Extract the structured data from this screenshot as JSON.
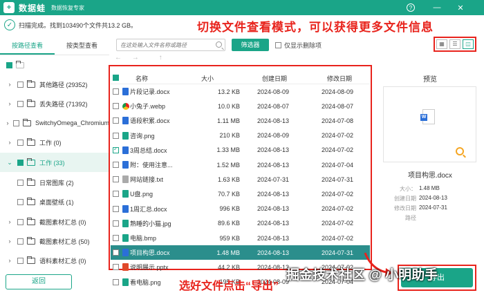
{
  "app": {
    "logo_char": "+",
    "name": "数据蛙",
    "subtitle": "数据恢复专家",
    "help": "?",
    "minimize": "—",
    "close": "✕"
  },
  "status": {
    "icon": "check-icon",
    "check_char": "✓",
    "text": "扫描完成。找到103490个文件共13.2 GB。"
  },
  "annotations": {
    "top": "切换文件查看模式，可以获得更多文件信息",
    "bottom": "选好文件点击“导出”",
    "watermark": "掘金技术社区 @ 小明助手"
  },
  "tabs": [
    {
      "label": "按路径查看",
      "active": true
    },
    {
      "label": "按类型查看",
      "active": false
    }
  ],
  "tree": [
    {
      "caret": "",
      "label": "",
      "state": "mixed"
    },
    {
      "caret": "›",
      "label": "其他路径 (29352)",
      "state": "unchecked"
    },
    {
      "caret": "›",
      "label": "丢失路径 (71392)",
      "state": "unchecked"
    },
    {
      "caret": "›",
      "label": "SwitchyOmega_Chromium",
      "state": "unchecked"
    },
    {
      "caret": "›",
      "label": "工作 (0)",
      "state": "unchecked"
    },
    {
      "caret": "⌄",
      "label": "工作 (33)",
      "state": "mixed"
    },
    {
      "caret": "",
      "label": "日常图库 (2)",
      "state": "unchecked"
    },
    {
      "caret": "",
      "label": "桌面壁纸 (1)",
      "state": "unchecked"
    },
    {
      "caret": "›",
      "label": "截图素材汇总 (0)",
      "state": "unchecked"
    },
    {
      "caret": "›",
      "label": "截图素材汇总 (50)",
      "state": "unchecked"
    },
    {
      "caret": "›",
      "label": "语料素材汇总 (0)",
      "state": "unchecked"
    }
  ],
  "back_button": "返回",
  "search": {
    "placeholder": "在这处输入文件名称或路径"
  },
  "filter_button": "筛选器",
  "show_deleted_only": "仅显示删除项",
  "view_modes": [
    "grid-view-icon",
    "list-view-icon",
    "detail-view-icon"
  ],
  "view_glyphs": [
    "▦",
    "☰",
    "◫"
  ],
  "nav": {
    "back": "←",
    "forward": "→",
    "up": "↑"
  },
  "table": {
    "headers": {
      "name": "名称",
      "size": "大小",
      "created": "创建日期",
      "modified": "修改日期"
    },
    "rows": [
      {
        "name": "片段记录.docx",
        "type": "docx",
        "size": "13.2 KB",
        "created": "2024-08-09",
        "modified": "2024-08-09",
        "checked": false,
        "selected": false
      },
      {
        "name": "小兔子.webp",
        "type": "webp",
        "size": "10.0 KB",
        "created": "2024-08-07",
        "modified": "2024-08-07",
        "checked": false,
        "selected": false
      },
      {
        "name": "语段积累.docx",
        "type": "docx",
        "size": "1.11 MB",
        "created": "2024-08-13",
        "modified": "2024-07-08",
        "checked": false,
        "selected": false
      },
      {
        "name": "咨询.png",
        "type": "png",
        "size": "210 KB",
        "created": "2024-08-09",
        "modified": "2024-07-02",
        "checked": false,
        "selected": false
      },
      {
        "name": "3周总结.docx",
        "type": "docx",
        "size": "1.33 MB",
        "created": "2024-08-13",
        "modified": "2024-07-02",
        "checked": true,
        "selected": false
      },
      {
        "name": "附：使用注意...",
        "type": "docx",
        "size": "1.52 MB",
        "created": "2024-08-13",
        "modified": "2024-07-04",
        "checked": false,
        "selected": false
      },
      {
        "name": "网站链接.txt",
        "type": "txt",
        "size": "1.63 KB",
        "created": "2024-07-31",
        "modified": "2024-07-31",
        "checked": false,
        "selected": false
      },
      {
        "name": "U盘.png",
        "type": "png",
        "size": "70.7 KB",
        "created": "2024-08-13",
        "modified": "2024-07-02",
        "checked": false,
        "selected": false
      },
      {
        "name": "1周汇总.docx",
        "type": "docx",
        "size": "996 KB",
        "created": "2024-08-13",
        "modified": "2024-07-02",
        "checked": false,
        "selected": false
      },
      {
        "name": "熟睡的小猫.jpg",
        "type": "png",
        "size": "89.6 KB",
        "created": "2024-08-13",
        "modified": "2024-07-02",
        "checked": false,
        "selected": false
      },
      {
        "name": "电脑.bmp",
        "type": "png",
        "size": "959 KB",
        "created": "2024-08-13",
        "modified": "2024-07-02",
        "checked": false,
        "selected": false
      },
      {
        "name": "项目构思.docx",
        "type": "docx",
        "size": "1.48 MB",
        "created": "2024-08-13",
        "modified": "2024-07-31",
        "checked": false,
        "selected": true
      },
      {
        "name": "说明展示.pptx",
        "type": "pptx",
        "size": "44.2 KB",
        "created": "2024-08-13",
        "modified": "2024-07-02",
        "checked": false,
        "selected": false
      },
      {
        "name": "看电脑.png",
        "type": "png",
        "size": "195 KB",
        "created": "2024-08-09",
        "modified": "2024-07-04",
        "checked": false,
        "selected": false
      }
    ]
  },
  "preview": {
    "title": "预览",
    "filename": "项目构思.docx",
    "meta": [
      {
        "key": "大小：",
        "value": "1.48 MB"
      },
      {
        "key": "创建日期",
        "value": "2024-08-13"
      },
      {
        "key": "修改日期",
        "value": "2024-07-31"
      },
      {
        "key": "路径",
        "value": ""
      }
    ]
  },
  "export_button": "导出",
  "colors": {
    "accent": "#1aa588",
    "annotation": "#e8231c",
    "selected_row": "#2b8e8c"
  }
}
